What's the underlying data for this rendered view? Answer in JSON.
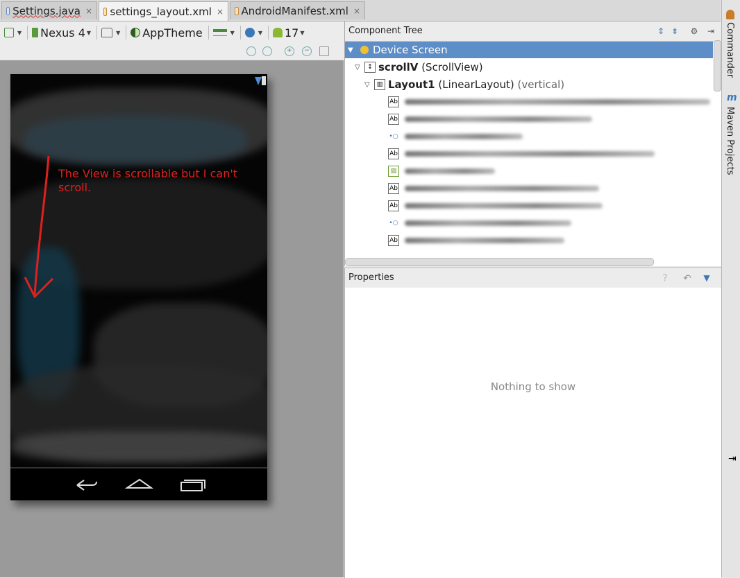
{
  "tabs": [
    {
      "label": "Settings.java",
      "icon": "java-class-icon",
      "close": "×"
    },
    {
      "label": "settings_layout.xml",
      "icon": "xml-layout-icon",
      "close": "×"
    },
    {
      "label": "AndroidManifest.xml",
      "icon": "xml-manifest-icon",
      "close": "×"
    }
  ],
  "toolbar": {
    "device": "Nexus 4",
    "theme": "AppTheme",
    "api": "17"
  },
  "preview": {
    "annotation": "The View is scrollable but I can't scroll."
  },
  "component_tree": {
    "title": "Component Tree",
    "device_screen": "Device Screen",
    "scroll_name": "scrollV",
    "scroll_type": "(ScrollView)",
    "layout_name": "Layout1",
    "layout_type": "(LinearLayout)",
    "layout_orient": "(vertical)",
    "child_icons": [
      "Ab",
      "Ab",
      "•○",
      "Ab",
      "▨",
      "Ab",
      "Ab",
      "•○",
      "Ab"
    ]
  },
  "properties": {
    "title": "Properties",
    "empty": "Nothing to show"
  },
  "right_strip": {
    "commander": "Commander",
    "maven": "Maven Projects",
    "maven_icon": "m"
  },
  "colors": {
    "selection": "#5e8ec7",
    "annotation": "#e0201c"
  }
}
